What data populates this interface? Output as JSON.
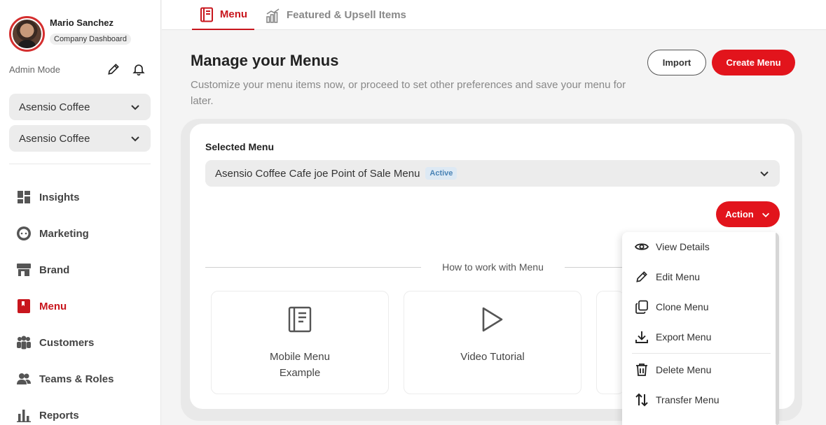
{
  "user": {
    "name": "Mario Sanchez",
    "badge": "Company Dashboard",
    "mode": "Admin Mode"
  },
  "sidebar": {
    "selects": [
      {
        "value": "Asensio Coffee"
      },
      {
        "value": "Asensio Coffee"
      }
    ],
    "items": [
      {
        "label": "Insights",
        "icon": "insights-icon"
      },
      {
        "label": "Marketing",
        "icon": "marketing-icon"
      },
      {
        "label": "Brand",
        "icon": "brand-store-icon"
      },
      {
        "label": "Menu",
        "icon": "menu-book-icon",
        "active": true
      },
      {
        "label": "Customers",
        "icon": "customers-icon"
      },
      {
        "label": "Teams & Roles",
        "icon": "teams-icon"
      },
      {
        "label": "Reports",
        "icon": "reports-chart-icon"
      }
    ]
  },
  "tabs": [
    {
      "label": "Menu",
      "icon": "menu-book-icon",
      "active": true
    },
    {
      "label": "Featured & Upsell Items",
      "icon": "chart-bars-icon"
    }
  ],
  "header": {
    "title": "Manage your Menus",
    "subtitle": "Customize your menu items now, or proceed to set other preferences and save your menu for later.",
    "import_label": "Import",
    "create_label": "Create Menu"
  },
  "selected_menu": {
    "label": "Selected Menu",
    "value": "Asensio Coffee Cafe joe Point of Sale Menu",
    "status": "Active"
  },
  "action_label": "Action",
  "how_to": {
    "title": "How to work with Menu",
    "tiles": [
      {
        "label": "Mobile Menu Example",
        "icon": "document-icon"
      },
      {
        "label": "Video Tutorial",
        "icon": "play-icon"
      }
    ]
  },
  "action_menu": [
    {
      "label": "View Details",
      "icon": "eye-icon"
    },
    {
      "label": "Edit Menu",
      "icon": "pencil-icon"
    },
    {
      "label": "Clone Menu",
      "icon": "clone-icon"
    },
    {
      "label": "Export Menu",
      "icon": "download-icon"
    },
    {
      "label": "Delete Menu",
      "icon": "trash-icon"
    },
    {
      "label": "Transfer Menu",
      "icon": "transfer-icon"
    }
  ],
  "colors": {
    "accent": "#e2141c",
    "active_text": "#c8161d",
    "active_pill_bg": "#dde9f4"
  }
}
